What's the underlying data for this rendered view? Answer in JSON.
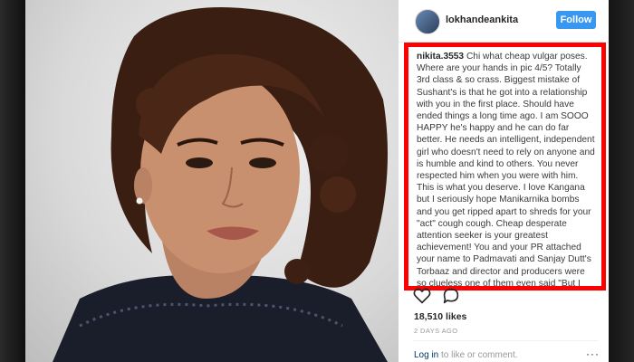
{
  "post": {
    "username": "lokhandeankita",
    "follow_label": "Follow",
    "likes": "18,510 likes",
    "time": "2 DAYS AGO",
    "login_link": "Log in",
    "login_rest": " to like or comment.",
    "more_icon": "···"
  },
  "comment": {
    "user": "nikita.3553",
    "text": " Chi what cheap vulgar poses. Where are your hands in pic 4/5? Totally 3rd class & so crass. Biggest mistake of Sushant's is that he got into a relationship with you in the first place. Should have ended things a long time ago. I am SOOO HAPPY he's happy and he can do far better. He needs an intelligent, independent girl who doesn't need to rely on anyone and is humble and kind to others. You never respected him when you were with him. This is what you deserve. I love Kangana but I seriously hope Manikarnika bombs and you get ripped apart to shreds for your \"act\" cough cough. Cheap desperate attention seeker is your greatest achievement! You and your PR attached your name to Padmavati and Sanjay Dutt's Torbaaz and director and producers were so clueless one of them even said \"But I don't even know Aankita mujhe maaf Kar"
  },
  "colors": {
    "follow_bg": "#3897f0",
    "highlight_border": "#ff0000",
    "username_text": "#262626"
  },
  "icons": {
    "like": "heart-icon",
    "comment": "comment-icon",
    "more": "more-options-icon"
  }
}
